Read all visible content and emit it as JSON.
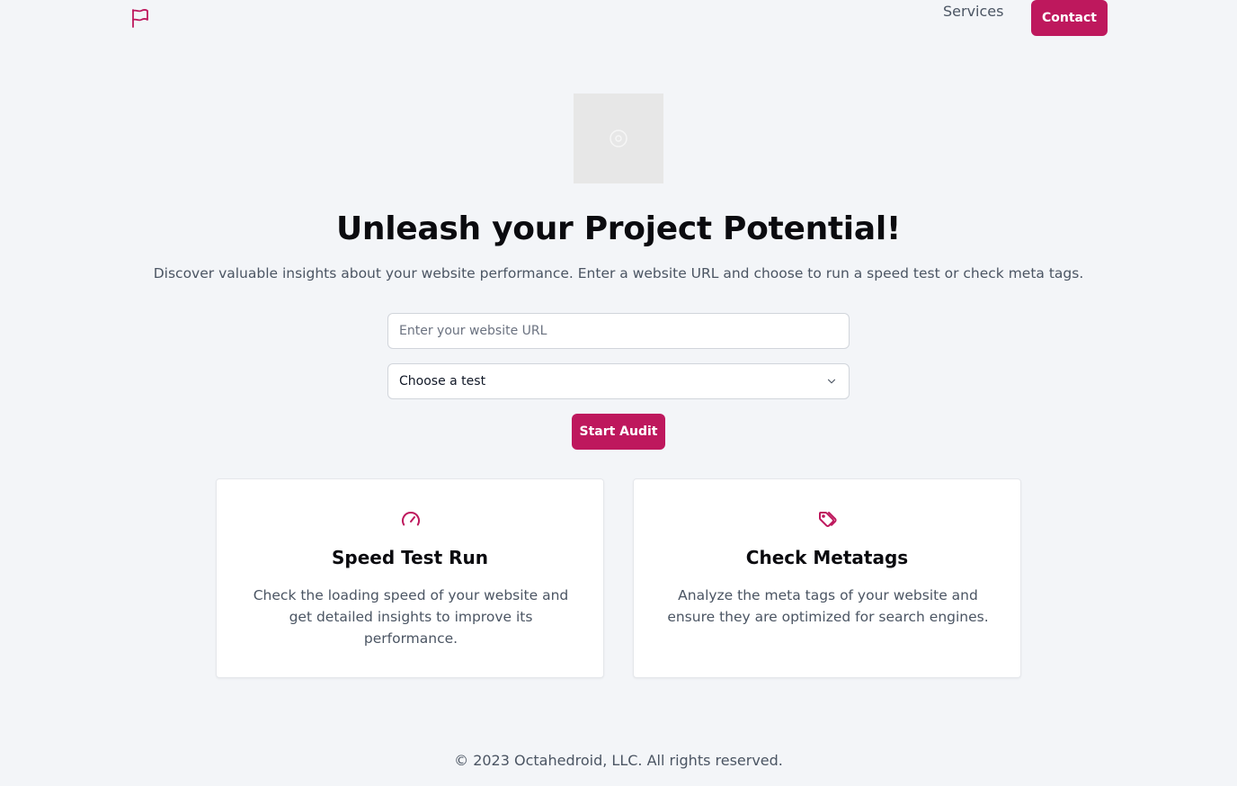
{
  "header": {
    "logo_icon": "flag-icon",
    "nav_services": "Services",
    "contact_label": "Contact"
  },
  "hero": {
    "image_icon": "image-placeholder-icon",
    "title": "Unleash your Project Potential!",
    "subtitle": "Discover valuable insights about your website performance. Enter a website URL and choose to run a speed test or check meta tags."
  },
  "form": {
    "url_placeholder": "Enter your website URL",
    "url_value": "",
    "test_select_value": "Choose a test",
    "submit_label": "Start Audit"
  },
  "cards": [
    {
      "icon": "speedometer-icon",
      "title": "Speed Test Run",
      "description": "Check the loading speed of your website and get detailed insights to improve its performance."
    },
    {
      "icon": "tags-icon",
      "title": "Check Metatags",
      "description": "Analyze the meta tags of your website and ensure they are optimized for search engines."
    }
  ],
  "footer": {
    "copyright": "© 2023 Octahedroid, LLC. All rights reserved."
  },
  "colors": {
    "accent": "#be185d",
    "background": "#f3f5f8",
    "text_muted": "#4b5563"
  }
}
